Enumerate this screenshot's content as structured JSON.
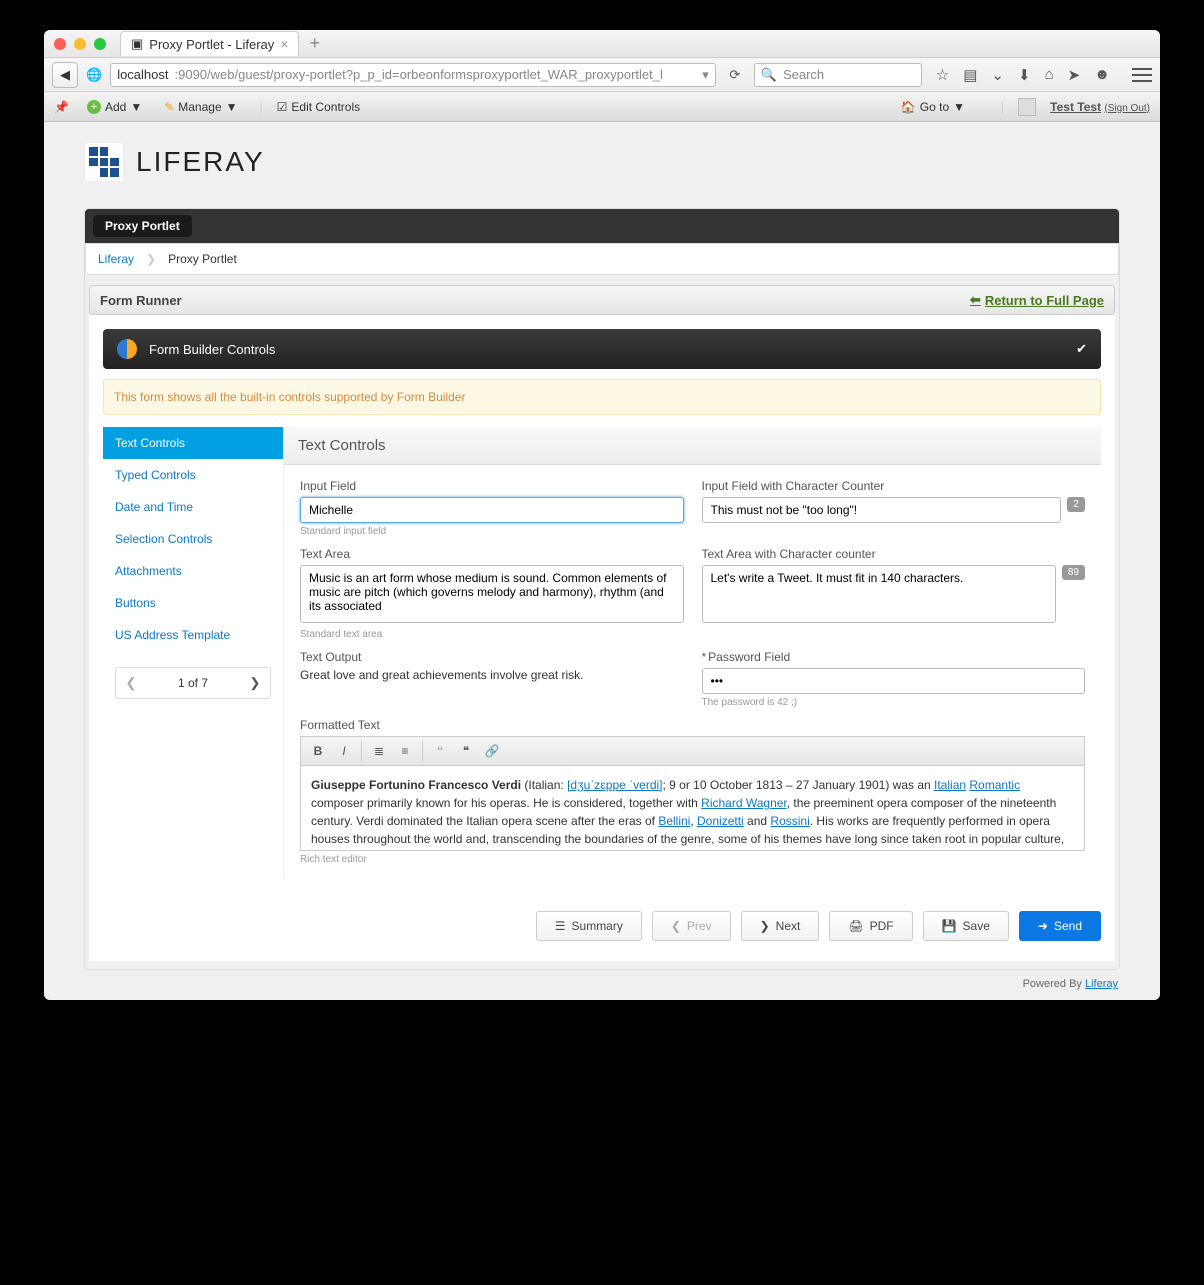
{
  "browser": {
    "tab_title": "Proxy Portlet - Liferay",
    "url_host": "localhost",
    "url_path": ":9090/web/guest/proxy-portlet?p_p_id=orbeonformsproxyportlet_WAR_proxyportlet_l",
    "search_placeholder": "Search"
  },
  "dockbar": {
    "add": "Add",
    "manage": "Manage",
    "edit_controls": "Edit Controls",
    "go_to": "Go to",
    "user_name": "Test Test",
    "sign_out": "(Sign Out)"
  },
  "logo_text": "LIFERAY",
  "proxy_chip": "Proxy Portlet",
  "breadcrumb": {
    "root": "Liferay",
    "current": "Proxy Portlet"
  },
  "frbar": {
    "label": "Form Runner",
    "return": "Return to Full Page"
  },
  "fb_header": "Form Builder Controls",
  "alert": "This form shows all the built-in controls supported by Form Builder",
  "sidenav": {
    "items": [
      "Text Controls",
      "Typed Controls",
      "Date and Time",
      "Selection Controls",
      "Attachments",
      "Buttons",
      "US Address Template"
    ],
    "active_index": 0
  },
  "pager": {
    "text": "1 of 7"
  },
  "section_title": "Text Controls",
  "fields": {
    "input": {
      "label": "Input Field",
      "value": "Michelle",
      "hint": "Standard input field"
    },
    "input_counter": {
      "label": "Input Field with Character Counter",
      "value": "This must not be \"too long\"!",
      "count": "2"
    },
    "textarea": {
      "label": "Text Area",
      "value": "Music is an art form whose medium is sound. Common elements of music are pitch (which governs melody and harmony), rhythm (and its associated",
      "hint": "Standard text area"
    },
    "textarea_counter": {
      "label": "Text Area with Character counter",
      "value": "Let's write a Tweet. It must fit in 140 characters.",
      "count": "89"
    },
    "text_output": {
      "label": "Text Output",
      "value": "Great love and great achievements involve great risk."
    },
    "password": {
      "label": "Password Field",
      "value": "•••",
      "hint": "The password is 42 ;)"
    },
    "formatted": {
      "label": "Formatted Text",
      "hint": "Rich text editor",
      "bold": "Giuseppe Fortunino Francesco Verdi",
      "body1": " (Italian: ",
      "link1": "[dʒuˈzɛppe ˈverdi]",
      "body2": "; 9 or 10 October 1813 – 27 January 1901) was an ",
      "link2": "Italian",
      "sp": " ",
      "link3": "Romantic",
      "body3": " composer primarily known for his operas. He is considered, together with ",
      "link4": "Richard Wagner",
      "body4": ", the preeminent opera composer of the nineteenth century. Verdi dominated the Italian opera scene after the eras of ",
      "link5": "Bellini",
      "c1": ", ",
      "link6": "Donizetti",
      "c2": " and ",
      "link7": "Rossini",
      "body5": ". His works are frequently performed in opera houses throughout the world and, transcending the boundaries of the genre, some of his themes have long since taken root in popular culture, as"
    }
  },
  "actions": {
    "summary": "Summary",
    "prev": "Prev",
    "next": "Next",
    "pdf": "PDF",
    "save": "Save",
    "send": "Send"
  },
  "footer": {
    "powered": "Powered By ",
    "link": "Liferay"
  }
}
